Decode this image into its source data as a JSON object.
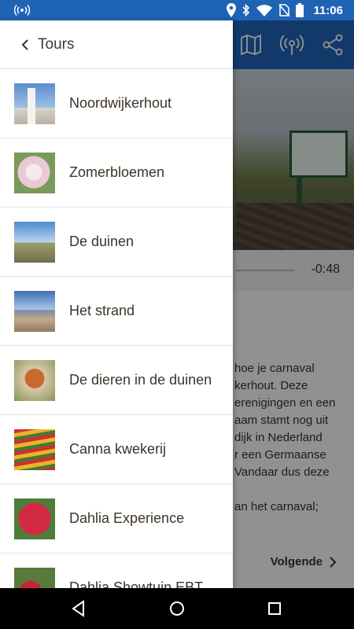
{
  "status_bar": {
    "time": "11:06",
    "icons": [
      "broadcast-icon",
      "location-icon",
      "bluetooth-icon",
      "wifi-icon",
      "no-sim-icon",
      "battery-icon"
    ]
  },
  "drawer": {
    "header": {
      "title": "Tours",
      "icon": "chevron-left-icon"
    },
    "items": [
      {
        "label": "Noordwijkerhout"
      },
      {
        "label": "Zomerbloemen"
      },
      {
        "label": "De duinen"
      },
      {
        "label": "Het strand"
      },
      {
        "label": "De dieren in de duinen"
      },
      {
        "label": "Canna kwekerij"
      },
      {
        "label": "Dahlia Experience"
      },
      {
        "label": "Dahlia Showtuin EBT"
      }
    ]
  },
  "background": {
    "appbar_icons": [
      "map-icon",
      "broadcast-icon",
      "share-icon"
    ],
    "player": {
      "remaining_time": "-0:48"
    },
    "article_lines": [
      "hoe je carnaval",
      "kerhout. Deze",
      "erenigingen en een",
      "aam stamt nog uit",
      "dijk in Nederland",
      "r een Germaanse",
      "Vandaar dus deze",
      "",
      "an het carnaval;"
    ],
    "next_label": "Volgende"
  },
  "colors": {
    "primary": "#1f63b5",
    "drawer_bg": "#ffffff",
    "text": "#3d3328"
  }
}
